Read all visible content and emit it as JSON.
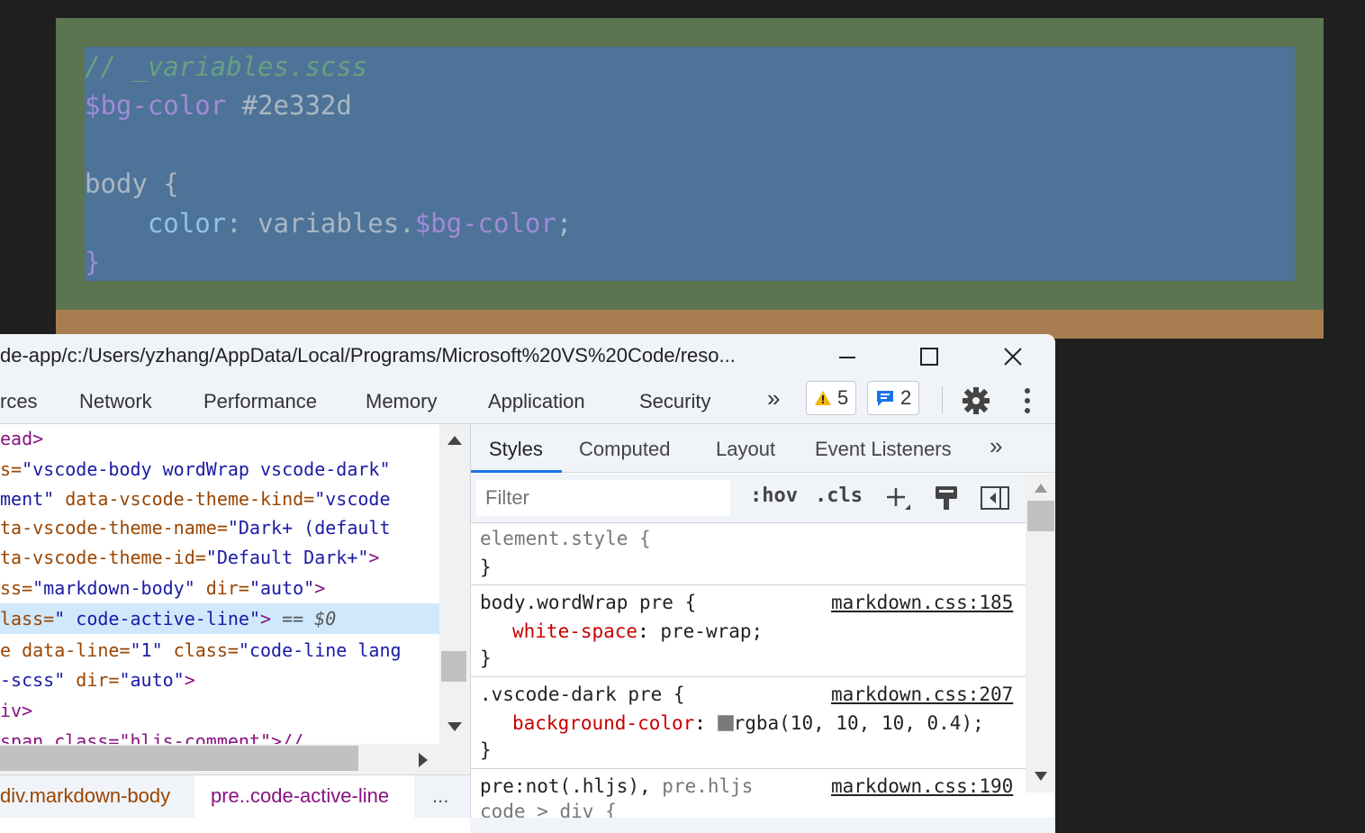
{
  "preview": {
    "comment": "// _variables.scss",
    "var_line": {
      "name": "$bg-color",
      "value": "#2e332d"
    },
    "body_open": "body {",
    "decl": {
      "prop": "color",
      "colon": ":",
      "ns": "variables.",
      "var": "$bg-color",
      "semi": ";"
    },
    "close": "}",
    "colors": {
      "margin": "#a87e50",
      "padding": "#5a7550",
      "content": "#4e7398"
    }
  },
  "window": {
    "title": "de-app/c:/Users/yzhang/AppData/Local/Programs/Microsoft%20VS%20Code/reso...",
    "minimize_icon": "minimize-icon",
    "maximize_icon": "maximize-icon",
    "close_icon": "close-icon"
  },
  "tabs": {
    "items": [
      "rces",
      "Network",
      "Performance",
      "Memory",
      "Application",
      "Security"
    ],
    "more": "»",
    "warnings": "5",
    "messages": "2"
  },
  "elements": {
    "lines": [
      {
        "a": "ead>"
      },
      {
        "a": "s=",
        "b": "\"vscode-body wordWrap vscode-dark\""
      },
      {
        "a": "ment\"",
        "b": " data-vscode-theme-kind=",
        "c": "\"vscode"
      },
      {
        "a": "ta-vscode-theme-name=",
        "b": "\"Dark+ (default"
      },
      {
        "a": "ta-vscode-theme-id=",
        "b": "\"Default Dark+\"",
        "c": ">"
      },
      {
        "a": "ss=",
        "b": "\"markdown-body\"",
        "c": " dir=",
        "d": "\"auto\"",
        "e": ">"
      },
      {
        "a": "lass=",
        "b": "\" code-active-line\"",
        "c": ">",
        "d": " == $0"
      },
      {
        "a": "e data-line=",
        "b": "\"1\"",
        "c": " class=",
        "d": "\"code-line lang"
      },
      {
        "a": "-scss\"",
        "b": " dir=",
        "c": "\"auto\"",
        "d": ">"
      },
      {
        "a": "iv>"
      },
      {
        "a": "span class=\"hljs-comment\">//"
      }
    ],
    "breadcrumbs": [
      "div.markdown-body",
      "pre..code-active-line",
      "..."
    ]
  },
  "styles": {
    "subtabs": [
      "Styles",
      "Computed",
      "Layout",
      "Event Listeners",
      "»"
    ],
    "filter_placeholder": "Filter",
    "hov": ":hov",
    "cls": ".cls",
    "rules": [
      {
        "selector": "element.style {",
        "close": "}"
      },
      {
        "selector": "body.wordWrap pre {",
        "source": "markdown.css:185",
        "prop": "white-space",
        "value": "pre-wrap;",
        "close": "}"
      },
      {
        "selector": ".vscode-dark pre {",
        "source": "markdown.css:207",
        "prop": "background-color",
        "value": "rgba(10, 10, 10, 0.4);",
        "close": "}"
      },
      {
        "selector_a": "pre:not(.hljs),",
        "selector_b": " pre.hljs",
        "source": "markdown.css:190",
        "next": "code > div {"
      }
    ]
  }
}
